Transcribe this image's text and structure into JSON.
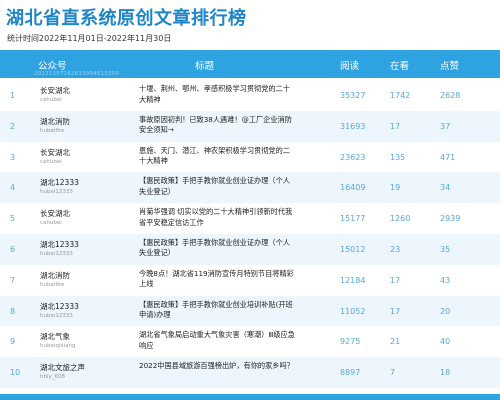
{
  "page": {
    "title": "湖北省直系统原创文章排行榜",
    "period": "统计时间2022年11月01日-2022年11月30日"
  },
  "table": {
    "headers": {
      "account": "公众号",
      "article": "标题",
      "reads": "阅读",
      "watching": "在看",
      "likes": "点赞"
    },
    "stamp": "20221207162633994813309",
    "rows": [
      {
        "rank": "1",
        "account": "长安湖北",
        "account_id": "cahubei",
        "title": "十堰、荆州、鄂州、孝感积极学习贯彻党的二十大精神",
        "reads": "35327",
        "watching": "1742",
        "likes": "2628"
      },
      {
        "rank": "2",
        "account": "湖北消防",
        "account_id": "hubeifire",
        "title": "事故原因初判！已致38人遇难！@工厂企业消防安全须知→",
        "reads": "31693",
        "watching": "17",
        "likes": "37"
      },
      {
        "rank": "3",
        "account": "长安湖北",
        "account_id": "cahubei",
        "title": "恩施、天门、潜江、神农架积极学习贯彻党的二十大精神",
        "reads": "23623",
        "watching": "135",
        "likes": "471"
      },
      {
        "rank": "4",
        "account": "湖北12333",
        "account_id": "hubei12333",
        "title": "【惠民政策】手把手教你就业创业证办理（个人失业登记）",
        "reads": "16409",
        "watching": "19",
        "likes": "34"
      },
      {
        "rank": "5",
        "account": "长安湖北",
        "account_id": "cahubei",
        "title": "肖菊华强调  切实以党的二十大精神引领新时代我省平安稳定信访工作",
        "reads": "15177",
        "watching": "1260",
        "likes": "2939"
      },
      {
        "rank": "6",
        "account": "湖北12333",
        "account_id": "hubei12333",
        "title": "【惠民政策】手把手教你就业创业证办理（个人失业登记）",
        "reads": "15012",
        "watching": "23",
        "likes": "35"
      },
      {
        "rank": "7",
        "account": "湖北消防",
        "account_id": "hubeifire",
        "title": "今晚8点！湖北省119消防宣传月特别节目将精彩上线",
        "reads": "12184",
        "watching": "17",
        "likes": "43"
      },
      {
        "rank": "8",
        "account": "湖北12333",
        "account_id": "hubei12333",
        "title": "【惠民政策】手把手教你就业创业培训补贴(开班申请)办理",
        "reads": "11052",
        "watching": "17",
        "likes": "20"
      },
      {
        "rank": "9",
        "account": "湖北气象",
        "account_id": "hubeiqixiang",
        "title": "湖北省气象局启动重大气象灾害（寒潮）Ⅲ级应急响应",
        "reads": "9275",
        "watching": "21",
        "likes": "40"
      },
      {
        "rank": "10",
        "account": "湖北文旅之声",
        "account_id": "hbly_608",
        "title": "2022中国县域旅游百强榜出炉，有你的家乡吗？",
        "reads": "8897",
        "watching": "7",
        "likes": "18"
      }
    ]
  },
  "colors": {
    "accent": "#2fa3e2",
    "title": "#1e86c6",
    "number": "#5aa7db",
    "alt_row": "#edf6fc"
  }
}
